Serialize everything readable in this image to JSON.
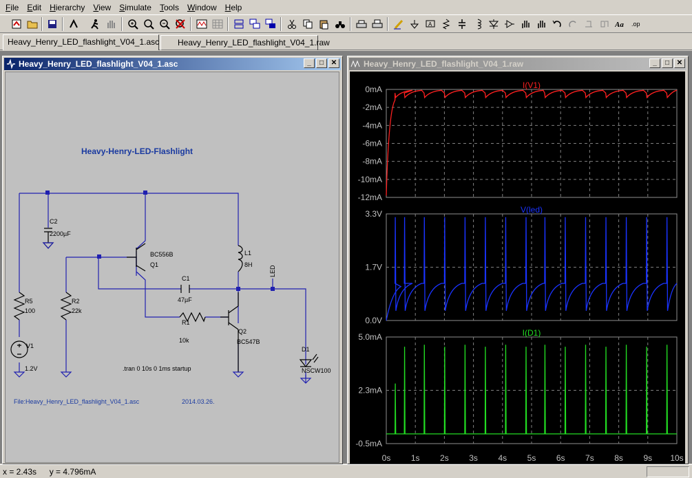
{
  "menu": [
    "File",
    "Edit",
    "Hierarchy",
    "View",
    "Simulate",
    "Tools",
    "Window",
    "Help"
  ],
  "menu_access": [
    "F",
    "E",
    "H",
    "V",
    "S",
    "T",
    "W",
    "H"
  ],
  "tabs": [
    {
      "label": "Heavy_Henry_LED_flashlight_V04_1.asc",
      "active": true
    },
    {
      "label": "Heavy_Henry_LED_flashlight_V04_1.raw",
      "active": false
    }
  ],
  "schematic_window": {
    "title": "Heavy_Henry_LED_flashlight_V04_1.asc",
    "heading": "Heavy-Henry-LED-Flashlight",
    "components": {
      "c2_name": "C2",
      "c2_value": "2200µF",
      "q1_model": "BC556B",
      "q1_name": "Q1",
      "l1_name": "L1",
      "l1_value": "8H",
      "led_label": "LED",
      "r5_name": "R5",
      "r5_value": "100",
      "r2_name": "R2",
      "r2_value": "22k",
      "c1_name": "C1",
      "c1_value": "47µF",
      "r1_name": "R1",
      "r1_value": "10k",
      "q2_name": "Q2",
      "q2_model": "BC547B",
      "v1_name": "V1",
      "v1_value": "1.2V",
      "d1_name": "D1",
      "d1_model": "NSCW100"
    },
    "directive": ".tran 0 10s 0 1ms startup",
    "file_label": "File:Heavy_Henry_LED_flashlight_V04_1.asc",
    "date": "2014.03.26."
  },
  "waveform_window": {
    "title": "Heavy_Henry_LED_flashlight_V04_1.raw",
    "x_ticks": [
      "0s",
      "1s",
      "2s",
      "3s",
      "4s",
      "5s",
      "6s",
      "7s",
      "8s",
      "9s",
      "10s"
    ],
    "panes": [
      {
        "trace": "I(V1)",
        "color": "#ff2020",
        "y_ticks": [
          "0mA",
          "-2mA",
          "-4mA",
          "-6mA",
          "-8mA",
          "-10mA",
          "-12mA"
        ]
      },
      {
        "trace": "V(led)",
        "color": "#1a33ff",
        "y_ticks": [
          "3.3V",
          "1.7V",
          "0.0V"
        ]
      },
      {
        "trace": "I(D1)",
        "color": "#22dd22",
        "y_ticks": [
          "5.0mA",
          "2.3mA",
          "-0.5mA"
        ]
      }
    ]
  },
  "chart_data": [
    {
      "type": "line",
      "title": "I(V1)",
      "xlabel": "",
      "ylabel": "",
      "xlim": [
        0,
        10
      ],
      "ylim": [
        -12,
        0
      ],
      "series": [
        {
          "name": "I(V1)",
          "pulse_times_s": [
            0.3,
            0.62,
            1.3,
            2.0,
            2.7,
            3.4,
            4.1,
            4.8,
            5.45,
            6.15,
            6.85,
            7.55,
            8.25,
            8.95,
            9.65
          ],
          "baseline_mA": -0.1,
          "pulse_min_mA": -0.9,
          "start_mA": -11.8
        }
      ]
    },
    {
      "type": "line",
      "title": "V(led)",
      "xlabel": "",
      "ylabel": "",
      "xlim": [
        0,
        10
      ],
      "ylim": [
        0,
        3.3
      ],
      "series": [
        {
          "name": "V(led)",
          "pulse_times_s": [
            0.3,
            0.62,
            1.3,
            2.0,
            2.7,
            3.4,
            4.1,
            4.8,
            5.45,
            6.15,
            6.85,
            7.55,
            8.25,
            8.95,
            9.65
          ],
          "baseline_V": 1.15,
          "peak_V": 3.2
        }
      ]
    },
    {
      "type": "line",
      "title": "I(D1)",
      "xlabel": "",
      "ylabel": "",
      "xlim": [
        0,
        10
      ],
      "ylim": [
        -0.5,
        5.0
      ],
      "series": [
        {
          "name": "I(D1)",
          "pulse_times_s": [
            0.3,
            0.62,
            1.3,
            2.0,
            2.7,
            3.4,
            4.1,
            4.8,
            5.45,
            6.15,
            6.85,
            7.55,
            8.25,
            8.95,
            9.65
          ],
          "baseline_mA": 0.0,
          "peak_mA": [
            2.6,
            4.5,
            4.6,
            4.5,
            4.6,
            4.5,
            4.6,
            4.5,
            4.6,
            4.5,
            4.6,
            4.5,
            4.6,
            4.5,
            4.6
          ]
        }
      ]
    }
  ],
  "status": {
    "x": "x = 2.43s",
    "y": "y = 4.796mA"
  }
}
